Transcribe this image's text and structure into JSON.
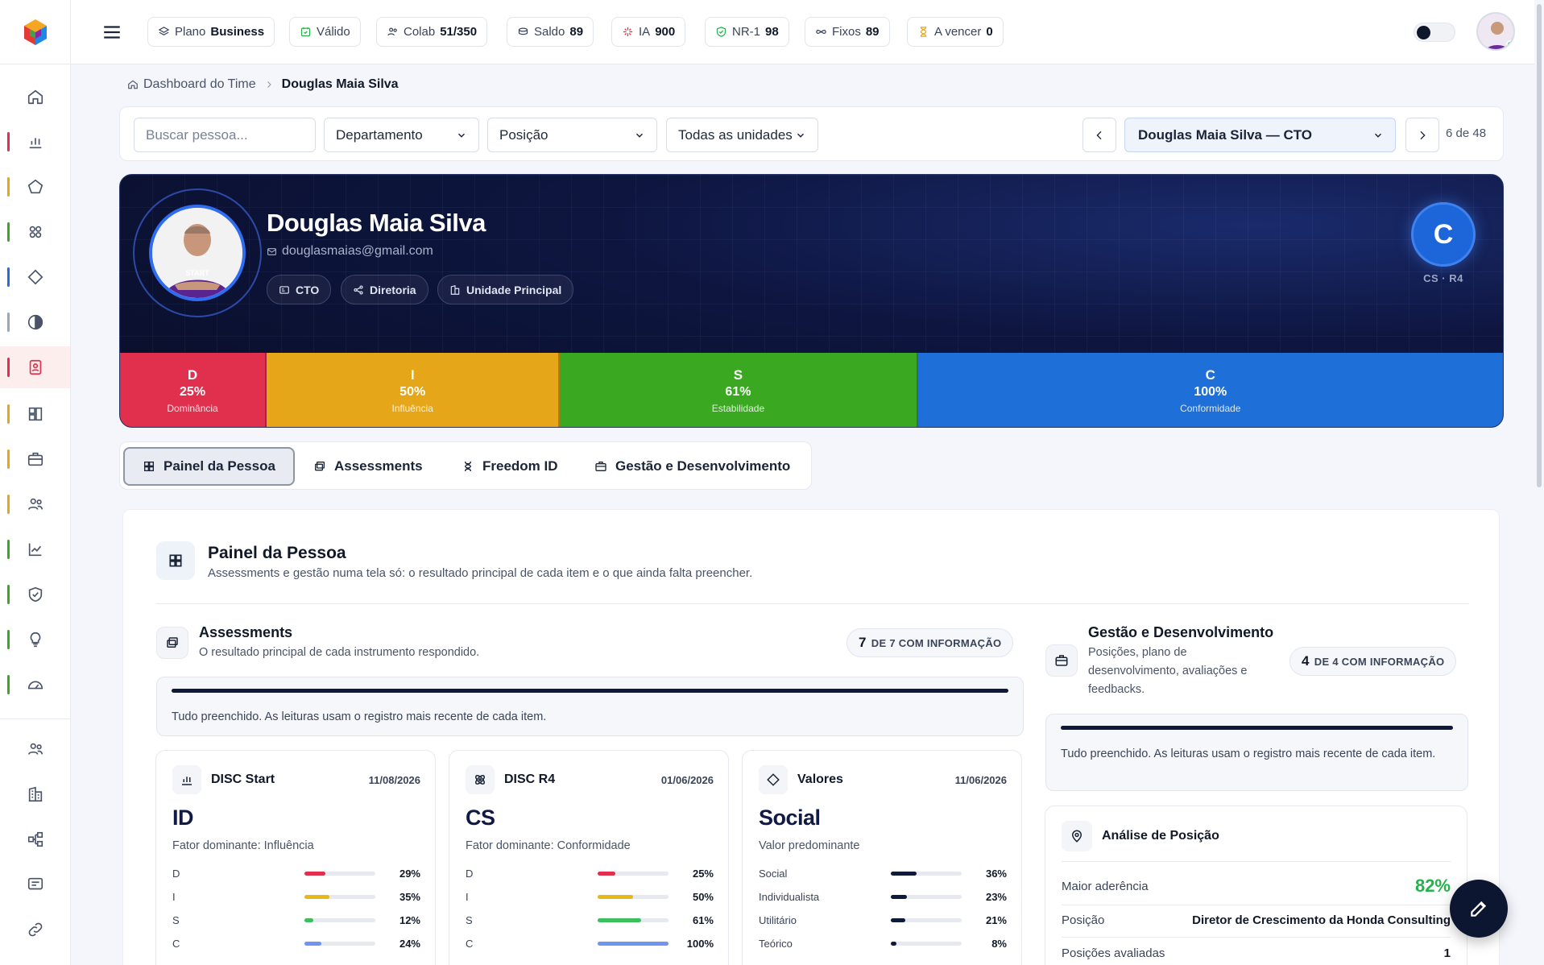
{
  "topbar": {
    "chips": [
      {
        "icon": "layers-icon",
        "label": "Plano",
        "value": "Business"
      },
      {
        "icon": "calendar-check-icon",
        "label": "Válido",
        "value": ""
      },
      {
        "icon": "users-icon",
        "label": "Colab",
        "value": "51/350"
      },
      {
        "icon": "coins-icon",
        "label": "Saldo",
        "value": "89"
      },
      {
        "icon": "sparkle-icon",
        "label": "IA",
        "value": "900"
      },
      {
        "icon": "shield-check-icon",
        "label": "NR-1",
        "value": "98"
      },
      {
        "icon": "infinity-icon",
        "label": "Fixos",
        "value": "89"
      },
      {
        "icon": "hourglass-icon",
        "label": "A vencer",
        "value": "0"
      }
    ]
  },
  "breadcrumb": {
    "parent": "Dashboard do Time",
    "current": "Douglas Maia Silva"
  },
  "filters": {
    "search_placeholder": "Buscar pessoa...",
    "department": "Departamento",
    "position": "Posição",
    "units": "Todas as unidades",
    "selected_person": "Douglas Maia Silva — CTO",
    "pager": "6 de 48"
  },
  "hero": {
    "name": "Douglas Maia Silva",
    "email": "douglasmaias@gmail.com",
    "tags": [
      {
        "icon": "id-card-icon",
        "label": "CTO"
      },
      {
        "icon": "network-icon",
        "label": "Diretoria"
      },
      {
        "icon": "building-icon",
        "label": "Unidade Principal"
      }
    ],
    "badge_letter": "C",
    "badge_sub": "CS · R4",
    "disc": [
      {
        "letter": "D",
        "percent": "25%",
        "name": "Dominância",
        "value": 25,
        "color": "#e0304e"
      },
      {
        "letter": "I",
        "percent": "50%",
        "name": "Influência",
        "value": 50,
        "color": "#e6a619"
      },
      {
        "letter": "S",
        "percent": "61%",
        "name": "Estabilidade",
        "value": 61,
        "color": "#3aa821"
      },
      {
        "letter": "C",
        "percent": "100%",
        "name": "Conformidade",
        "value": 100,
        "color": "#1f6fd8"
      }
    ]
  },
  "tabs": [
    {
      "icon": "grid-icon",
      "label": "Painel da Pessoa",
      "active": true
    },
    {
      "icon": "window-icon",
      "label": "Assessments"
    },
    {
      "icon": "dna-icon",
      "label": "Freedom ID"
    },
    {
      "icon": "briefcase-icon",
      "label": "Gestão e Desenvolvimento"
    }
  ],
  "panel": {
    "title": "Painel da Pessoa",
    "subtitle": "Assessments e gestão numa tela só: o resultado principal de cada item e o que ainda falta preencher.",
    "assessments": {
      "title": "Assessments",
      "subtitle": "O resultado principal de cada instrumento respondido.",
      "count": "7",
      "count_label": "DE 7 COM INFORMAÇÃO",
      "info": "Tudo preenchido. As leituras usam o registro mais recente de cada item.",
      "progress": 1.0
    },
    "gestao": {
      "title": "Gestão e Desenvolvimento",
      "subtitle": "Posições, plano de desenvolvimento, avaliações e feedbacks.",
      "count": "4",
      "count_label": "DE 4 COM INFORMAÇÃO",
      "info": "Tudo preenchido. As leituras usam o registro mais recente de cada item.",
      "progress": 1.0
    },
    "cards": [
      {
        "icon": "bar-chart-icon",
        "title": "DISC Start",
        "date": "11/08/2026",
        "big": "ID",
        "sub": "Fator dominante: Influência",
        "rows": [
          {
            "label": "D",
            "value": "29%",
            "pct": 29,
            "color": "#e0304e"
          },
          {
            "label": "I",
            "value": "35%",
            "pct": 35,
            "color": "#e6b919"
          },
          {
            "label": "S",
            "value": "12%",
            "pct": 12,
            "color": "#3cbf5c"
          },
          {
            "label": "C",
            "value": "24%",
            "pct": 24,
            "color": "#6f95f0"
          }
        ]
      },
      {
        "icon": "atom-icon",
        "title": "DISC R4",
        "date": "01/06/2026",
        "big": "CS",
        "sub": "Fator dominante: Conformidade",
        "rows": [
          {
            "label": "D",
            "value": "25%",
            "pct": 25,
            "color": "#e0304e"
          },
          {
            "label": "I",
            "value": "50%",
            "pct": 50,
            "color": "#e6b919"
          },
          {
            "label": "S",
            "value": "61%",
            "pct": 61,
            "color": "#3cbf5c"
          },
          {
            "label": "C",
            "value": "100%",
            "pct": 100,
            "color": "#6f95f0"
          }
        ]
      },
      {
        "icon": "diamond-icon",
        "title": "Valores",
        "date": "11/06/2026",
        "big": "Social",
        "sub": "Valor predominante",
        "rows": [
          {
            "label": "Social",
            "value": "36%",
            "pct": 36,
            "color": "#0f1a3a"
          },
          {
            "label": "Individualista",
            "value": "23%",
            "pct": 23,
            "color": "#0f1a3a"
          },
          {
            "label": "Utilitário",
            "value": "21%",
            "pct": 21,
            "color": "#0f1a3a"
          },
          {
            "label": "Teórico",
            "value": "8%",
            "pct": 8,
            "color": "#0f1a3a"
          }
        ]
      }
    ],
    "position_card": {
      "title": "Análise de Posição",
      "rows": [
        {
          "label": "Maior aderência",
          "value": "82%"
        },
        {
          "label": "Posição",
          "value": "Diretor de Crescimento da Honda Consulting"
        },
        {
          "label": "Posições avaliadas",
          "value": "1"
        }
      ]
    }
  }
}
